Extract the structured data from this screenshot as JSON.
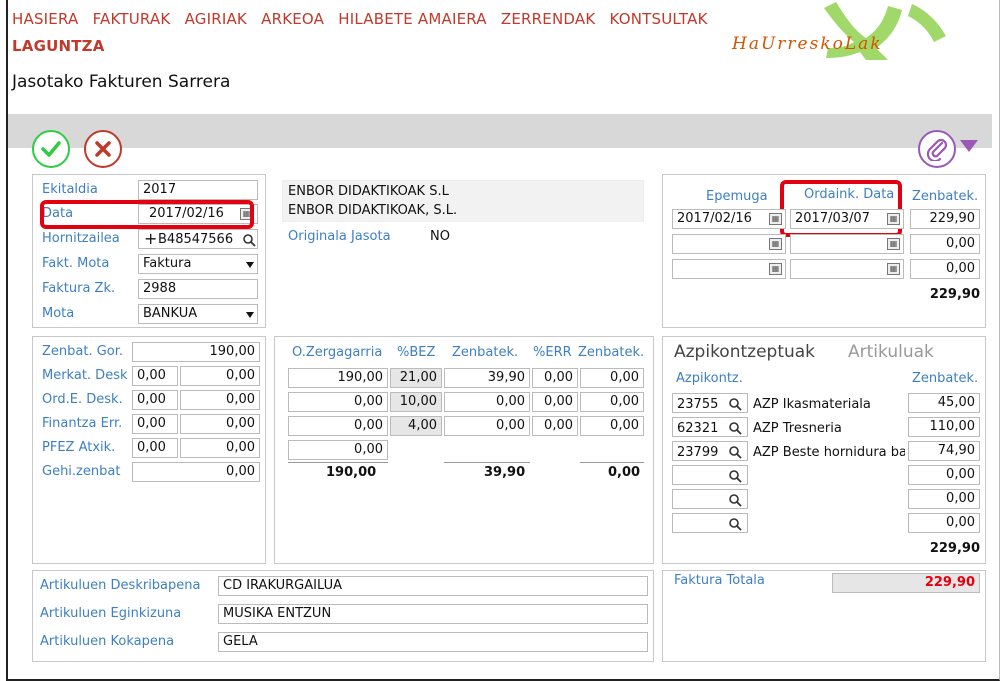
{
  "menu": {
    "items": [
      "HASIERA",
      "FAKTURAK",
      "AGIRIAK",
      "ARKEOA",
      "HILABETE AMAIERA",
      "ZERRENDAK",
      "KONTSULTAK"
    ],
    "second": "LAGUNTZA"
  },
  "logo": {
    "text": "HaUrreskoLak"
  },
  "page": {
    "title": "Jasotako Fakturen Sarrera"
  },
  "header_form": {
    "ekitaldia_label": "Ekitaldia",
    "ekitaldia_value": "2017",
    "data_label": "Data",
    "data_value": "2017/02/16",
    "hornitzailea_label": "Hornitzailea",
    "hornitzailea_value": "B48547566",
    "fakt_mota_label": "Fakt. Mota",
    "fakt_mota_value": "Faktura",
    "faktura_zk_label": "Faktura Zk.",
    "faktura_zk_value": "2988",
    "mota_label": "Mota",
    "mota_value": "BANKUA"
  },
  "supplier": {
    "name1": "ENBOR DIDAKTIKOAK S.L",
    "name2": "ENBOR DIDAKTIKOAK, S.L.",
    "originala_label": "Originala Jasota",
    "originala_value": "NO"
  },
  "due": {
    "h_epemuga": "Epemuga",
    "h_ordaink": "Ordaink. Data",
    "h_zenbatek": "Zenbatek.",
    "rows": [
      {
        "epemuga": "2017/02/16",
        "ordaink": "2017/03/07",
        "zenbatek": "229,90"
      },
      {
        "epemuga": "",
        "ordaink": "",
        "zenbatek": "0,00"
      },
      {
        "epemuga": "",
        "ordaink": "",
        "zenbatek": "0,00"
      }
    ],
    "total": "229,90"
  },
  "amounts": {
    "zenbat_gor_label": "Zenbat. Gor.",
    "zenbat_gor": "190,00",
    "rows": [
      {
        "label": "Merkat. Desk",
        "pct": "0,00",
        "val": "0,00"
      },
      {
        "label": "Ord.E. Desk.",
        "pct": "0,00",
        "val": "0,00"
      },
      {
        "label": "Finantza Err.",
        "pct": "0,00",
        "val": "0,00"
      },
      {
        "label": "PFEZ Atxik.",
        "pct": "0,00",
        "val": "0,00"
      }
    ],
    "gehi_label": "Gehi.zenbat",
    "gehi": "0,00"
  },
  "vat": {
    "h_ozerg": "O.Zergagarria",
    "h_bez": "%BEZ",
    "h_zenbatek": "Zenbatek.",
    "h_err": "%ERR",
    "h_zenbatek2": "Zenbatek.",
    "rows": [
      {
        "base": "190,00",
        "bez": "21,00",
        "amt": "39,90",
        "err": "0,00",
        "amt2": "0,00"
      },
      {
        "base": "0,00",
        "bez": "10,00",
        "amt": "0,00",
        "err": "0,00",
        "amt2": "0,00"
      },
      {
        "base": "0,00",
        "bez": "4,00",
        "amt": "0,00",
        "err": "0,00",
        "amt2": "0,00"
      },
      {
        "base": "0,00"
      }
    ],
    "tot_base": "190,00",
    "tot_amt": "39,90",
    "tot_amt2": "0,00"
  },
  "subconcepts": {
    "tab1": "Azpikontzeptuak",
    "tab2": "Artikuluak",
    "h_code": "Azpikontz.",
    "h_amount": "Zenbatek.",
    "rows": [
      {
        "code": "23755",
        "desc": "AZP Ikasmateriala",
        "amount": "45,00"
      },
      {
        "code": "62321",
        "desc": "AZP Tresneria",
        "amount": "110,00"
      },
      {
        "code": "23799",
        "desc": "AZP Beste hornidura ba",
        "amount": "74,90"
      },
      {
        "code": "",
        "desc": "",
        "amount": "0,00"
      },
      {
        "code": "",
        "desc": "",
        "amount": "0,00"
      },
      {
        "code": "",
        "desc": "",
        "amount": "0,00"
      }
    ],
    "total": "229,90"
  },
  "articles": {
    "desk_label": "Artikuluen Deskribapena",
    "desk_value": "CD IRAKURGAILUA",
    "egink_label": "Artikuluen Eginkizuna",
    "egink_value": "MUSIKA ENTZUN",
    "kok_label": "Artikuluen Kokapena",
    "kok_value": "GELA"
  },
  "totals": {
    "label": "Faktura Totala",
    "value": "229,90"
  },
  "colors": {
    "menu": "#c0392b",
    "label": "#3d7fc1",
    "highlight": "#e3000f",
    "ok": "#2ecc40",
    "attach": "#9b59b6"
  }
}
